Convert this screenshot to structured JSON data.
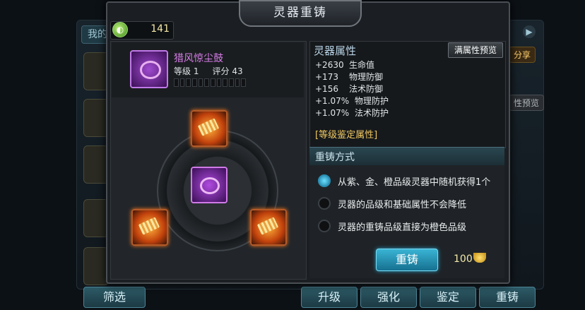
{
  "background": {
    "tab_label": "我的",
    "filter_label": "筛选",
    "share_label": "分享",
    "preview_label": "性预览",
    "bottom_buttons": [
      "升级",
      "强化",
      "鉴定",
      "重铸"
    ]
  },
  "dialog": {
    "title": "灵器重铸",
    "currency": {
      "value": "141",
      "icon": "green-coin-icon"
    },
    "item": {
      "name": "猎风惊尘鼓",
      "level_label": "等级 1",
      "score_label": "评分 43",
      "progress_segments": 12
    },
    "attributes": {
      "title": "灵器属性",
      "full_preview_label": "满属性预览",
      "rows": [
        {
          "value": "+2630",
          "name": "生命值"
        },
        {
          "value": "+173",
          "name": "物理防御"
        },
        {
          "value": "+156",
          "name": "法术防御"
        },
        {
          "value": "+1.07%",
          "name": "物理防护"
        },
        {
          "value": "+1.07%",
          "name": "法术防护"
        }
      ],
      "grade_title": "[等级鉴定属性]"
    },
    "method": {
      "title": "重铸方式",
      "options": [
        {
          "label": "从紫、金、橙品级灵器中随机获得1个",
          "selected": true
        },
        {
          "label": "灵器的品级和基础属性不会降低",
          "selected": false
        },
        {
          "label": "灵器的重铸品级直接为橙色品级",
          "selected": false
        }
      ]
    },
    "recast_button": "重铸",
    "cost": {
      "value": "100",
      "icon": "gold-ingot-icon"
    }
  },
  "colors": {
    "accent": "#3ab4d4",
    "item_name": "#d77de8",
    "gold": "#f0c860"
  }
}
